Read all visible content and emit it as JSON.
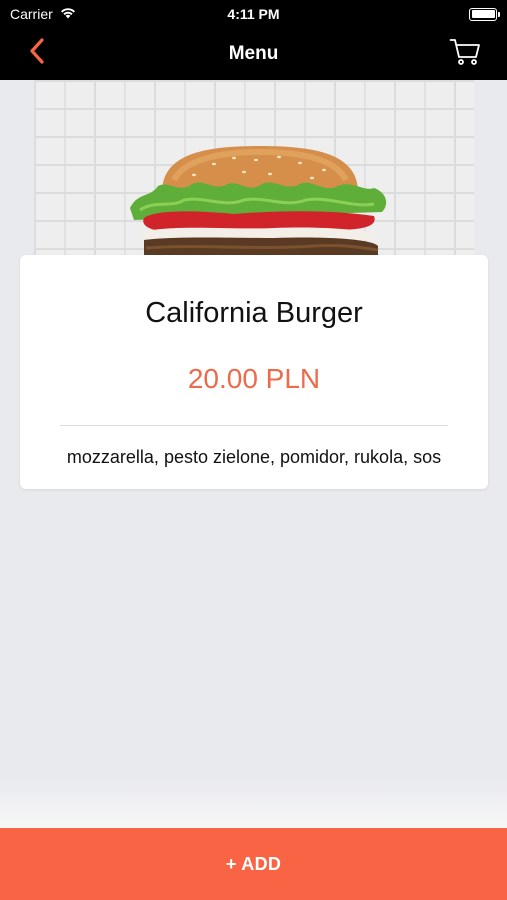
{
  "status_bar": {
    "carrier": "Carrier",
    "time": "4:11 PM",
    "icons": [
      "wifi-icon",
      "battery-icon"
    ]
  },
  "nav": {
    "title": "Menu",
    "back_icon": "chevron-left-icon",
    "cart_icon": "cart-icon"
  },
  "item": {
    "image": "burger-photo",
    "name": "California Burger",
    "price": "20.00 PLN",
    "description": "mozzarella, pesto zielone, pomidor, rukola, sos"
  },
  "actions": {
    "add_label": "+ ADD"
  },
  "colors": {
    "accent": "#f96544",
    "price": "#ec6b4b",
    "nav_background": "#000000",
    "page_background": "#e9eaee"
  }
}
